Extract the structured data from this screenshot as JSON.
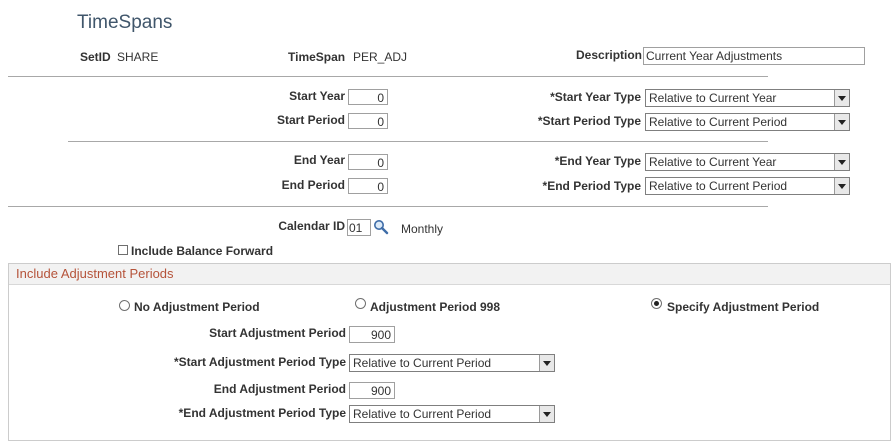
{
  "page": {
    "title": "TimeSpans"
  },
  "header": {
    "setid_label": "SetID",
    "setid_value": "SHARE",
    "timespan_label": "TimeSpan",
    "timespan_value": "PER_ADJ",
    "description_label": "Description",
    "description_value": "Current Year Adjustments"
  },
  "start": {
    "year_label": "Start Year",
    "year_value": "0",
    "period_label": "Start Period",
    "period_value": "0",
    "year_type_label": "*Start Year Type",
    "year_type_value": "Relative to Current Year",
    "period_type_label": "*Start Period Type",
    "period_type_value": "Relative to Current Period"
  },
  "end": {
    "year_label": "End Year",
    "year_value": "0",
    "period_label": "End Period",
    "period_value": "0",
    "year_type_label": "*End Year Type",
    "year_type_value": "Relative to Current Year",
    "period_type_label": "*End Period Type",
    "period_type_value": "Relative to Current Period"
  },
  "calendar": {
    "label": "Calendar ID",
    "value": "01",
    "description": "Monthly",
    "include_balance_forward_label": "Include Balance Forward",
    "include_balance_forward_checked": false
  },
  "adjustment": {
    "group_title": "Include Adjustment Periods",
    "options": [
      {
        "label": "No Adjustment Period",
        "selected": false
      },
      {
        "label": "Adjustment Period 998",
        "selected": false
      },
      {
        "label": "Specify Adjustment Period",
        "selected": true
      }
    ],
    "start_label": "Start Adjustment Period",
    "start_value": "900",
    "start_type_label": "*Start Adjustment Period Type",
    "start_type_value": "Relative to Current Period",
    "end_label": "End Adjustment Period",
    "end_value": "900",
    "end_type_label": "*End Adjustment Period Type",
    "end_type_value": "Relative to Current Period"
  }
}
